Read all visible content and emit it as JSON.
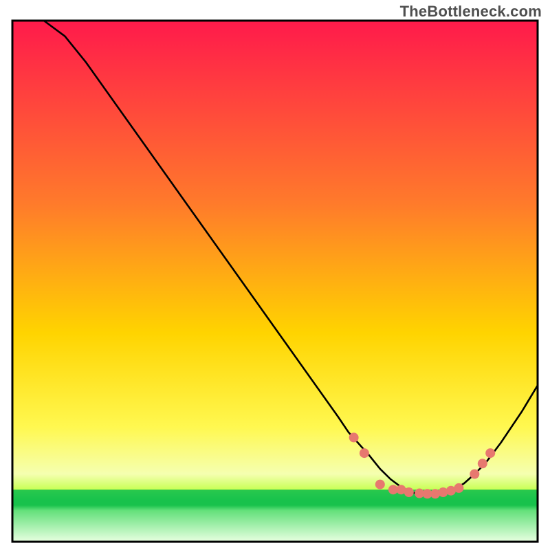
{
  "attribution": "TheBottleneck.com",
  "chart_data": {
    "type": "line",
    "title": "",
    "xlabel": "",
    "ylabel": "",
    "xlim": [
      0,
      100
    ],
    "ylim": [
      0,
      100
    ],
    "grid": false,
    "curve": [
      {
        "x": 6,
        "y": 100
      },
      {
        "x": 10,
        "y": 97
      },
      {
        "x": 14,
        "y": 92
      },
      {
        "x": 62,
        "y": 24
      },
      {
        "x": 64,
        "y": 21
      },
      {
        "x": 68,
        "y": 16.5
      },
      {
        "x": 70,
        "y": 14
      },
      {
        "x": 72,
        "y": 12
      },
      {
        "x": 74,
        "y": 10.5
      },
      {
        "x": 76,
        "y": 9.5
      },
      {
        "x": 78,
        "y": 9
      },
      {
        "x": 80,
        "y": 9
      },
      {
        "x": 82,
        "y": 9.2
      },
      {
        "x": 84,
        "y": 10
      },
      {
        "x": 86,
        "y": 11.2
      },
      {
        "x": 88,
        "y": 13
      },
      {
        "x": 90,
        "y": 15
      },
      {
        "x": 93,
        "y": 19
      },
      {
        "x": 97,
        "y": 25
      },
      {
        "x": 100,
        "y": 30
      }
    ],
    "dots": [
      {
        "x": 65,
        "y": 20
      },
      {
        "x": 67,
        "y": 17
      },
      {
        "x": 70,
        "y": 11
      },
      {
        "x": 72.5,
        "y": 10
      },
      {
        "x": 74,
        "y": 10
      },
      {
        "x": 75.5,
        "y": 9.5
      },
      {
        "x": 77.5,
        "y": 9.3
      },
      {
        "x": 79,
        "y": 9.2
      },
      {
        "x": 80.5,
        "y": 9.2
      },
      {
        "x": 82,
        "y": 9.5
      },
      {
        "x": 83.5,
        "y": 9.8
      },
      {
        "x": 85,
        "y": 10.3
      },
      {
        "x": 88,
        "y": 13
      },
      {
        "x": 89.5,
        "y": 15
      },
      {
        "x": 91,
        "y": 17
      }
    ],
    "band_green_start": 7,
    "band_green_end": 10,
    "colors": {
      "top": "#ff1a4b",
      "mid": "#ffe400",
      "bottom_band_start": "#c8ff55",
      "green": "#18c24c",
      "curve": "#000000",
      "dot": "#e7786f"
    }
  }
}
